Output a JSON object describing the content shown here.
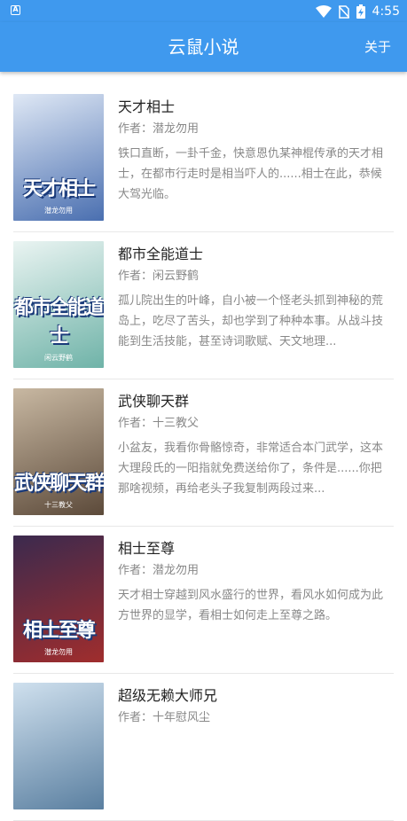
{
  "status_bar": {
    "time": "4:55"
  },
  "app_bar": {
    "title": "云鼠小说",
    "about_label": "关于"
  },
  "books": [
    {
      "title": "天才相士",
      "author": "作者：潜龙勿用",
      "description": "铁口直断，一卦千金，快意恩仇某神棍传承的天才相士，在都市行走时是相当吓人的......相士在此，恭候大驾光临。",
      "cover_title": "天才相士",
      "cover_author": "潜龙勿用",
      "cover_colors": [
        "#dfe8f5",
        "#4a6fb0"
      ]
    },
    {
      "title": "都市全能道士",
      "author": "作者：闲云野鹤",
      "description": "孤儿院出生的叶峰，自小被一个怪老头抓到神秘的荒岛上，吃尽了苦头，却也学到了种种本事。从战斗技能到生活技能，甚至诗词歌赋、天文地理...",
      "cover_title": "都市全能道士",
      "cover_author": "闲云野鹤",
      "cover_colors": [
        "#eaf4f2",
        "#6fb3a8"
      ]
    },
    {
      "title": "武侠聊天群",
      "author": "作者：十三教父",
      "description": "小盆友，我看你骨骼惊奇，非常适合本门武学，这本大理段氏的一阳指就免费送给你了，条件是......你把那啥视频，再给老头子我复制两段过来...",
      "cover_title": "武侠聊天群",
      "cover_author": "十三教父",
      "cover_colors": [
        "#c8b8a2",
        "#5c4a3a"
      ]
    },
    {
      "title": "相士至尊",
      "author": "作者：潜龙勿用",
      "description": "天才相士穿越到风水盛行的世界，看风水如何成为此方世界的显学，看相士如何走上至尊之路。",
      "cover_title": "相士至尊",
      "cover_author": "潜龙勿用",
      "cover_colors": [
        "#3b2a4e",
        "#a02d2d"
      ]
    },
    {
      "title": "超级无赖大师兄",
      "author": "作者：十年慰风尘",
      "description": "",
      "cover_title": "",
      "cover_author": "",
      "cover_colors": [
        "#cfe0ee",
        "#5a7fa0"
      ]
    }
  ]
}
